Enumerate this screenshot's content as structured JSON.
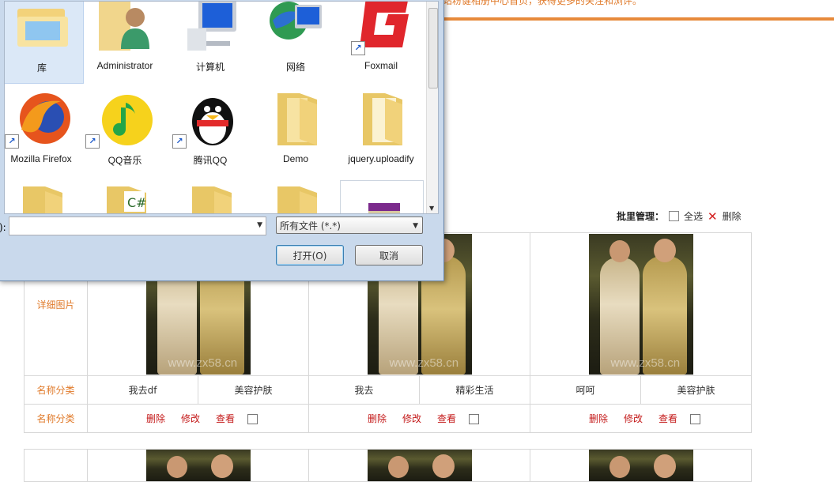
{
  "page": {
    "top_note": "站粉健相册中心首页，获得更多的关注和浏评。",
    "batch": {
      "label": "批里管理：",
      "select_all": "全选",
      "delete": "删除"
    },
    "rows": {
      "detail_label": "详细图片",
      "name_label": "名称分类",
      "ops_label": "名称分类"
    },
    "watermark": "www.zx58.cn",
    "items": [
      {
        "name": "我去df",
        "category": "美容护肤"
      },
      {
        "name": "我去",
        "category": "精彩生活"
      },
      {
        "name": "呵呵",
        "category": "美容护肤"
      }
    ],
    "ops": {
      "delete": "删除",
      "edit": "修改",
      "view": "查看"
    }
  },
  "dialog": {
    "files": [
      {
        "name": "库",
        "icon": "library-icon"
      },
      {
        "name": "Administrator",
        "icon": "user-folder-icon"
      },
      {
        "name": "计算机",
        "icon": "computer-icon"
      },
      {
        "name": "网络",
        "icon": "network-icon"
      },
      {
        "name": "Foxmail",
        "icon": "foxmail-icon"
      },
      {
        "name": "Mozilla Firefox",
        "icon": "firefox-icon"
      },
      {
        "name": "QQ音乐",
        "icon": "qqmusic-icon"
      },
      {
        "name": "腾讯QQ",
        "icon": "qq-penguin-icon"
      },
      {
        "name": "Demo",
        "icon": "folder-icon"
      },
      {
        "name": "jquery.uploadify",
        "icon": "folder-icon"
      }
    ],
    "filename_label": "):",
    "filename_value": "",
    "filetype": "所有文件 (*.*)",
    "open_button": "打开(O)",
    "cancel_button": "取消"
  }
}
